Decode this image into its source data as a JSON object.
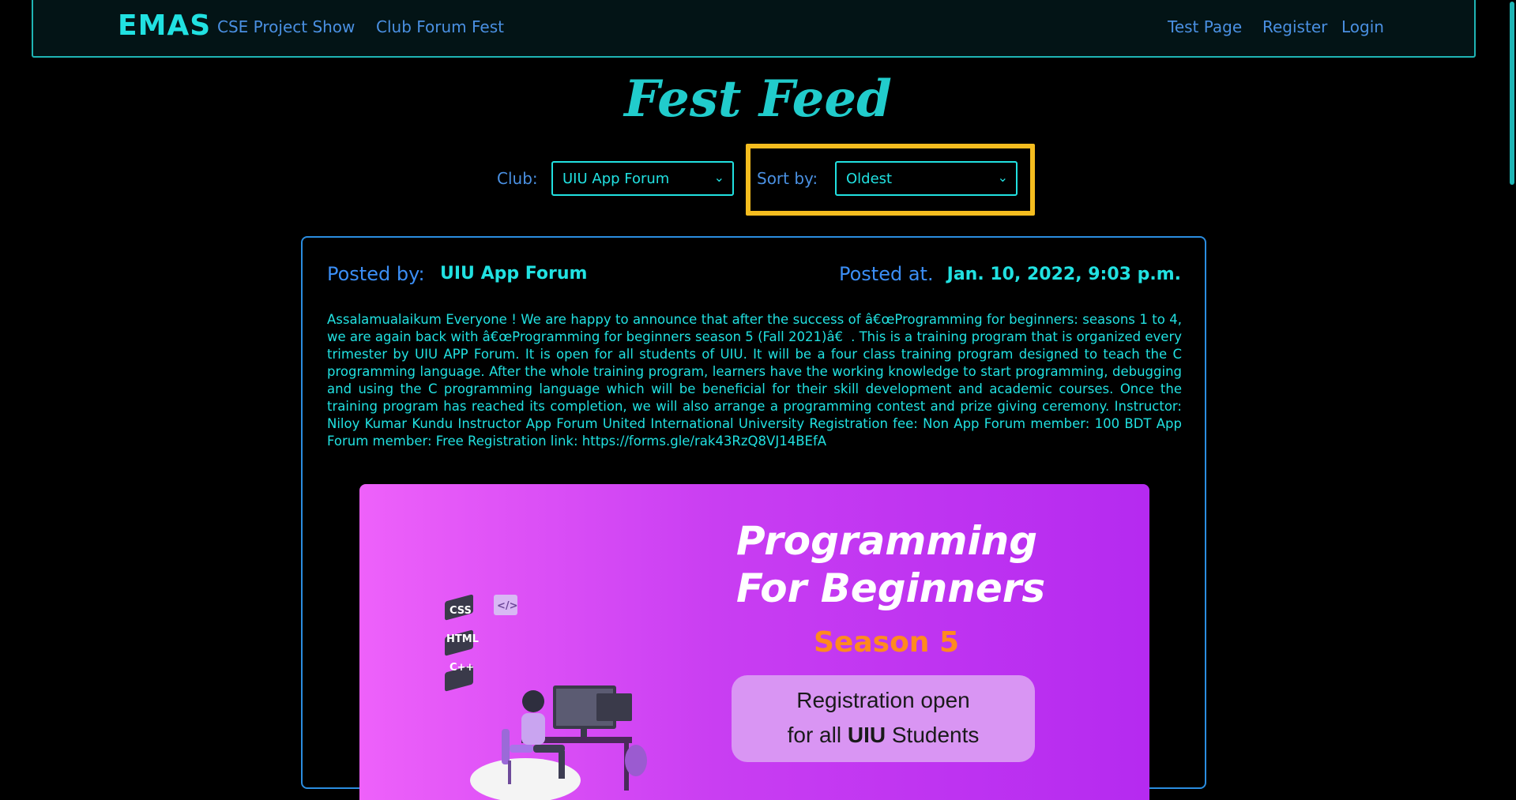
{
  "navbar": {
    "brand": "EMAS",
    "links_left": [
      "CSE Project Show",
      "Club Forum Fest"
    ],
    "links_right": [
      "Test Page",
      "Register",
      "Login"
    ]
  },
  "page": {
    "title": "Fest Feed"
  },
  "filters": {
    "club_label": "Club:",
    "club_value": "UIU App Forum",
    "sort_label": "Sort by:",
    "sort_value": "Oldest"
  },
  "post": {
    "posted_by_label": "Posted by:",
    "posted_by_value": "UIU App Forum",
    "posted_at_label": "Posted at.",
    "posted_at_value": "Jan. 10, 2022, 9:03 p.m.",
    "body": "Assalamualaikum Everyone ! We are happy to announce that after the success of â€œProgramming for beginners: seasons 1 to 4, we are again back with â€œProgramming for beginners season 5 (Fall 2021)â€. This is a training program that is organized every trimester by UIU APP Forum. It is open for all students of UIU. It will be a four class training program designed to teach the C programming language. After the whole training program, learners have the working knowledge to start programming, debugging and using the C programming language which will be beneficial for their skill development and academic courses. Once the training program has reached its completion, we will also arrange a programming contest and prize giving ceremony. Instructor: Niloy Kumar Kundu Instructor App Forum United International University Registration fee: Non App Forum member: 100 BDT App Forum member: Free Registration link: https://forms.gle/rak43RzQ8VJ14BEfA",
    "banner": {
      "title_line1": "Programming",
      "title_line2": "For Beginners",
      "season": "Season 5",
      "pill_line1": "Registration open",
      "pill_line2_prefix": "for all ",
      "pill_line2_bold": "UIU",
      "pill_line2_suffix": " Students",
      "tags": [
        "CSS",
        "HTML",
        "C++",
        "</>"
      ]
    }
  },
  "colors": {
    "accent_cyan": "#21e1e1",
    "link_blue": "#4a90e2",
    "highlight_yellow": "#f5bd1f",
    "card_border": "#2b8de0"
  }
}
